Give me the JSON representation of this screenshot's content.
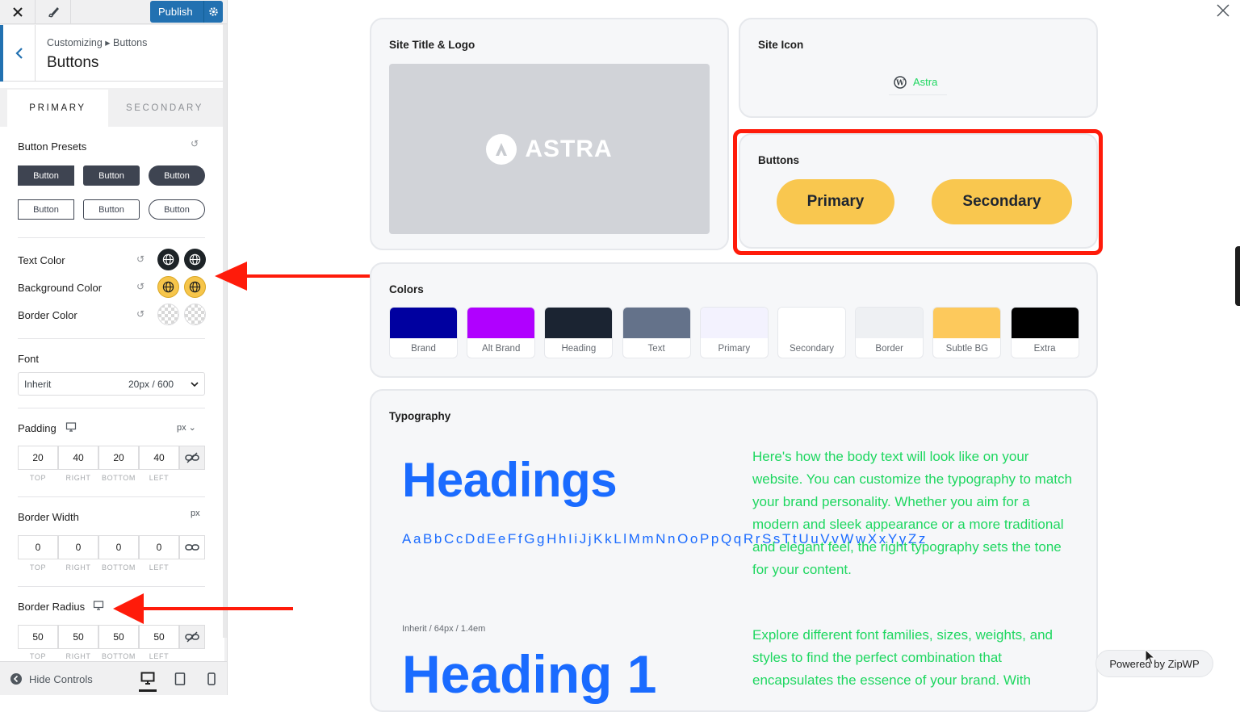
{
  "topbar": {
    "publish_label": "Publish"
  },
  "header": {
    "breadcrumb": "Customizing ▸ Buttons",
    "title": "Buttons"
  },
  "tabs": [
    {
      "label": "PRIMARY"
    },
    {
      "label": "SECONDARY"
    }
  ],
  "presets": {
    "label": "Button Presets",
    "filled": [
      "Button",
      "Button",
      "Button"
    ],
    "outline": [
      "Button",
      "Button",
      "Button"
    ]
  },
  "colors_controls": {
    "text_color": "Text Color",
    "background_color": "Background Color",
    "border_color": "Border Color"
  },
  "font": {
    "label": "Font",
    "family": "Inherit",
    "size_weight": "20px / 600"
  },
  "padding": {
    "label": "Padding",
    "unit": "px",
    "values": [
      "20",
      "40",
      "20",
      "40"
    ],
    "sides": [
      "TOP",
      "RIGHT",
      "BOTTOM",
      "LEFT"
    ]
  },
  "border_width": {
    "label": "Border Width",
    "unit": "px",
    "values": [
      "0",
      "0",
      "0",
      "0"
    ],
    "sides": [
      "TOP",
      "RIGHT",
      "BOTTOM",
      "LEFT"
    ]
  },
  "border_radius": {
    "label": "Border Radius",
    "unit": "px",
    "values": [
      "50",
      "50",
      "50",
      "50"
    ],
    "sides": [
      "TOP",
      "RIGHT",
      "BOTTOM",
      "LEFT"
    ]
  },
  "footer": {
    "hide_controls": "Hide Controls"
  },
  "preview": {
    "site_title_card": "Site Title & Logo",
    "logo_text": "ASTRA",
    "site_icon_card": "Site Icon",
    "site_icon_label": "Astra",
    "buttons_card": "Buttons",
    "primary_button": "Primary",
    "secondary_button": "Secondary",
    "colors_card": "Colors",
    "colors": [
      {
        "name": "Brand",
        "hex": "#0000a0"
      },
      {
        "name": "Alt Brand",
        "hex": "#b000ff"
      },
      {
        "name": "Heading",
        "hex": "#1b2432"
      },
      {
        "name": "Text",
        "hex": "#64728a"
      },
      {
        "name": "Primary",
        "hex": "#f3f2fe"
      },
      {
        "name": "Secondary",
        "hex": "#ffffff"
      },
      {
        "name": "Border",
        "hex": "#eef0f3"
      },
      {
        "name": "Subtle BG",
        "hex": "#fdc95c"
      },
      {
        "name": "Extra",
        "hex": "#000000"
      }
    ],
    "typography_card": "Typography",
    "headings_sample": "Headings",
    "alphabet": "AaBbCcDdEeFfGgHhIiJjKkLlMmNnOoPpQqRrSsTtUuVvWwXxYyZz",
    "heading1_meta": "Inherit / 64px / 1.4em",
    "heading1_sample": "Heading 1",
    "body_text_1": "Here's how the body text will look like on your website. You can customize the typography to match your brand personality. Whether you aim for a modern and sleek appearance or a more traditional and elegant feel, the right typography sets the tone for your content.",
    "body_text_2": "Explore different font families, sizes, weights, and styles to find the perfect combination that encapsulates the essence of your brand. With",
    "powered_by": "Powered by ZipWP"
  },
  "accent_colors": {
    "wp_blue": "#2271b1",
    "button_gold": "#f9c74f",
    "highlight_red": "#ff1b0a",
    "heading_blue": "#1a6bff",
    "body_green": "#1ed760"
  }
}
